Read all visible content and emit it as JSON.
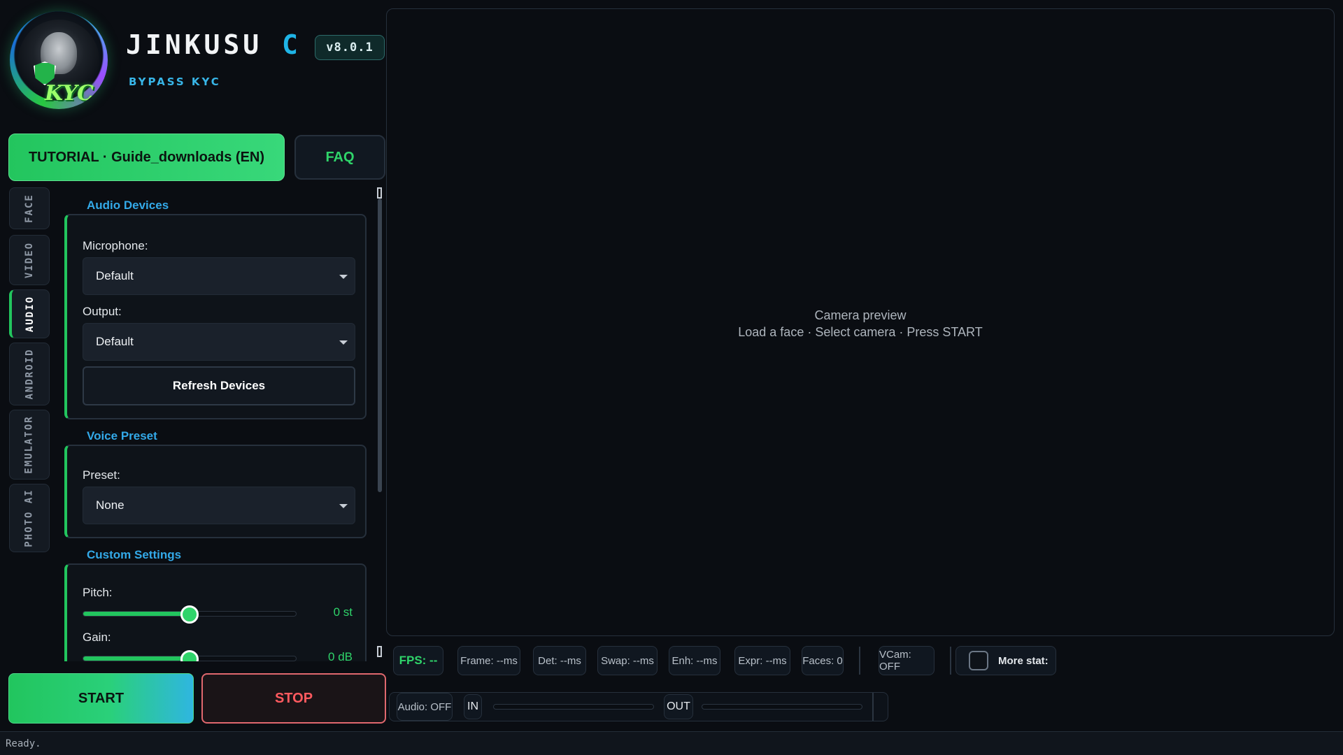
{
  "header": {
    "brand_main": "JINKUSU",
    "brand_accent": "C/",
    "subtitle": "BYPASS KYC",
    "version": "v8.0.1",
    "logo_text": "KYC"
  },
  "top_buttons": {
    "tutorial_label": "TUTORIAL  ·  Guide_downloads (EN)",
    "faq_label": "FAQ"
  },
  "tabs": [
    {
      "label": "FACE",
      "active": false
    },
    {
      "label": "VIDEO",
      "active": false
    },
    {
      "label": "AUDIO",
      "active": true
    },
    {
      "label": "ANDROID",
      "active": false
    },
    {
      "label": "EMULATOR",
      "active": false
    },
    {
      "label": "PHOTO AI",
      "active": false
    }
  ],
  "audio_devices": {
    "title": "Audio Devices",
    "microphone_label": "Microphone:",
    "microphone_value": "Default",
    "output_label": "Output:",
    "output_value": "Default",
    "refresh_label": "Refresh Devices"
  },
  "voice_preset": {
    "title": "Voice Preset",
    "preset_label": "Preset:",
    "preset_value": "None"
  },
  "custom_settings": {
    "title": "Custom Settings",
    "pitch_label": "Pitch:",
    "pitch_value": "0 st",
    "pitch_fraction": 0.5,
    "gain_label": "Gain:",
    "gain_value": "0 dB",
    "gain_fraction": 0.5
  },
  "controls": {
    "start_label": "START",
    "stop_label": "STOP"
  },
  "preview": {
    "title": "Camera preview",
    "hint": "Load a face  ·  Select camera  ·  Press START"
  },
  "stats": {
    "fps": "FPS: --",
    "frame": "Frame: --ms",
    "det": "Det: --ms",
    "swap": "Swap: --ms",
    "enh": "Enh: --ms",
    "expr": "Expr: --ms",
    "faces": "Faces: 0",
    "vcam": "VCam: OFF",
    "more_stats": "More stat:"
  },
  "audio_meter": {
    "status": "Audio: OFF",
    "in_label": "IN",
    "out_label": "OUT"
  },
  "status_bar": {
    "text": "Ready."
  },
  "colors": {
    "accent_green": "#22c55e",
    "accent_blue": "#33a9e8",
    "stop_red": "#ff5a5f",
    "background": "#0a0d12"
  }
}
